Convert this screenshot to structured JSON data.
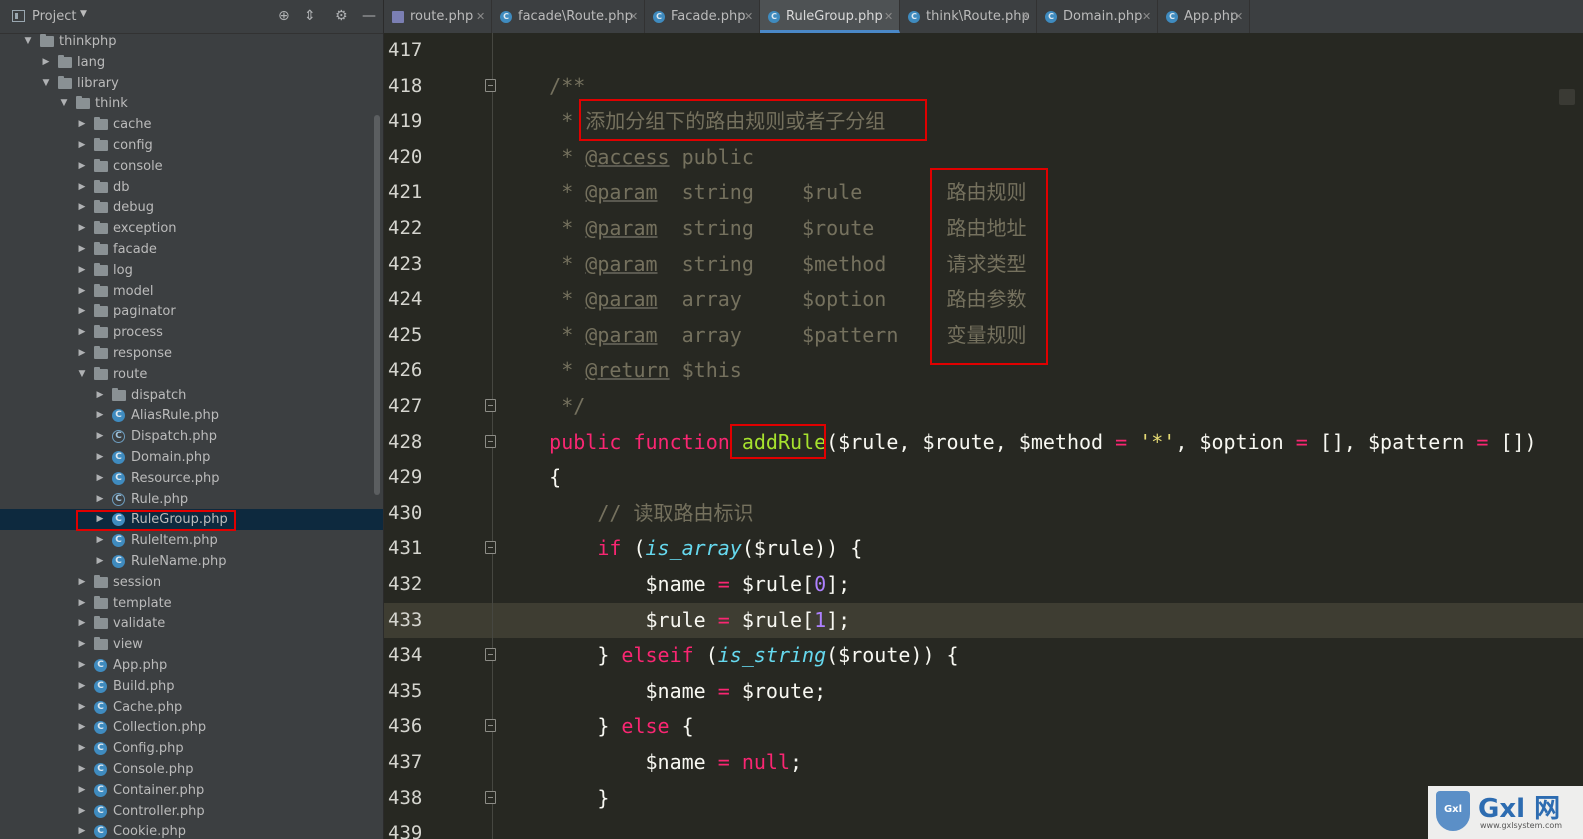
{
  "sidebar": {
    "title": "Project",
    "tree": [
      {
        "label": "thinkphp",
        "type": "folder",
        "depth": 0,
        "expanded": true
      },
      {
        "label": "lang",
        "type": "folder",
        "depth": 1,
        "expanded": false
      },
      {
        "label": "library",
        "type": "folder",
        "depth": 1,
        "expanded": true
      },
      {
        "label": "think",
        "type": "folder",
        "depth": 2,
        "expanded": true
      },
      {
        "label": "cache",
        "type": "folder",
        "depth": 3,
        "expanded": false
      },
      {
        "label": "config",
        "type": "folder",
        "depth": 3,
        "expanded": false
      },
      {
        "label": "console",
        "type": "folder",
        "depth": 3,
        "expanded": false
      },
      {
        "label": "db",
        "type": "folder",
        "depth": 3,
        "expanded": false
      },
      {
        "label": "debug",
        "type": "folder",
        "depth": 3,
        "expanded": false
      },
      {
        "label": "exception",
        "type": "folder",
        "depth": 3,
        "expanded": false
      },
      {
        "label": "facade",
        "type": "folder",
        "depth": 3,
        "expanded": false
      },
      {
        "label": "log",
        "type": "folder",
        "depth": 3,
        "expanded": false
      },
      {
        "label": "model",
        "type": "folder",
        "depth": 3,
        "expanded": false
      },
      {
        "label": "paginator",
        "type": "folder",
        "depth": 3,
        "expanded": false
      },
      {
        "label": "process",
        "type": "folder",
        "depth": 3,
        "expanded": false
      },
      {
        "label": "response",
        "type": "folder",
        "depth": 3,
        "expanded": false
      },
      {
        "label": "route",
        "type": "folder",
        "depth": 3,
        "expanded": true
      },
      {
        "label": "dispatch",
        "type": "folder",
        "depth": 4,
        "expanded": false
      },
      {
        "label": "AliasRule.php",
        "type": "class",
        "depth": 4
      },
      {
        "label": "Dispatch.php",
        "type": "abstract",
        "depth": 4
      },
      {
        "label": "Domain.php",
        "type": "class",
        "depth": 4
      },
      {
        "label": "Resource.php",
        "type": "class",
        "depth": 4
      },
      {
        "label": "Rule.php",
        "type": "abstract",
        "depth": 4
      },
      {
        "label": "RuleGroup.php",
        "type": "class",
        "depth": 4,
        "selected": true
      },
      {
        "label": "RuleItem.php",
        "type": "class",
        "depth": 4
      },
      {
        "label": "RuleName.php",
        "type": "class",
        "depth": 4
      },
      {
        "label": "session",
        "type": "folder",
        "depth": 3,
        "expanded": false
      },
      {
        "label": "template",
        "type": "folder",
        "depth": 3,
        "expanded": false
      },
      {
        "label": "validate",
        "type": "folder",
        "depth": 3,
        "expanded": false
      },
      {
        "label": "view",
        "type": "folder",
        "depth": 3,
        "expanded": false
      },
      {
        "label": "App.php",
        "type": "class",
        "depth": 3
      },
      {
        "label": "Build.php",
        "type": "class",
        "depth": 3
      },
      {
        "label": "Cache.php",
        "type": "class",
        "depth": 3
      },
      {
        "label": "Collection.php",
        "type": "class",
        "depth": 3
      },
      {
        "label": "Config.php",
        "type": "class",
        "depth": 3
      },
      {
        "label": "Console.php",
        "type": "class",
        "depth": 3
      },
      {
        "label": "Container.php",
        "type": "class",
        "depth": 3
      },
      {
        "label": "Controller.php",
        "type": "class",
        "depth": 3
      },
      {
        "label": "Cookie.php",
        "type": "class",
        "depth": 3
      }
    ]
  },
  "tabs": [
    {
      "label": "route.php",
      "icon": "php",
      "active": false
    },
    {
      "label": "facade\\Route.php",
      "icon": "class",
      "active": false
    },
    {
      "label": "Facade.php",
      "icon": "class",
      "active": false
    },
    {
      "label": "RuleGroup.php",
      "icon": "class",
      "active": true
    },
    {
      "label": "think\\Route.php",
      "icon": "class",
      "active": false
    },
    {
      "label": "Domain.php",
      "icon": "class",
      "active": false
    },
    {
      "label": "App.php",
      "icon": "class",
      "active": false
    }
  ],
  "editor": {
    "lines": [
      {
        "n": "417",
        "fold": false,
        "tokens": []
      },
      {
        "n": "418",
        "fold": true,
        "tokens": [
          [
            "c-cm",
            "    /**"
          ]
        ]
      },
      {
        "n": "419",
        "fold": false,
        "tokens": [
          [
            "c-cm",
            "     * 添加分组下的路由规则或者子分组"
          ]
        ]
      },
      {
        "n": "420",
        "fold": false,
        "tokens": [
          [
            "c-cm",
            "     * "
          ],
          [
            "doc-tag",
            "@access"
          ],
          [
            "c-cm",
            " public"
          ]
        ]
      },
      {
        "n": "421",
        "fold": false,
        "tokens": [
          [
            "c-cm",
            "     * "
          ],
          [
            "doc-tag",
            "@param"
          ],
          [
            "c-cm",
            "  string    $rule       路由规则"
          ]
        ]
      },
      {
        "n": "422",
        "fold": false,
        "tokens": [
          [
            "c-cm",
            "     * "
          ],
          [
            "doc-tag",
            "@param"
          ],
          [
            "c-cm",
            "  string    $route      路由地址"
          ]
        ]
      },
      {
        "n": "423",
        "fold": false,
        "tokens": [
          [
            "c-cm",
            "     * "
          ],
          [
            "doc-tag",
            "@param"
          ],
          [
            "c-cm",
            "  string    $method     请求类型"
          ]
        ]
      },
      {
        "n": "424",
        "fold": false,
        "tokens": [
          [
            "c-cm",
            "     * "
          ],
          [
            "doc-tag",
            "@param"
          ],
          [
            "c-cm",
            "  array     $option     路由参数"
          ]
        ]
      },
      {
        "n": "425",
        "fold": false,
        "tokens": [
          [
            "c-cm",
            "     * "
          ],
          [
            "doc-tag",
            "@param"
          ],
          [
            "c-cm",
            "  array     $pattern    变量规则"
          ]
        ]
      },
      {
        "n": "426",
        "fold": false,
        "tokens": [
          [
            "c-cm",
            "     * "
          ],
          [
            "doc-tag",
            "@return"
          ],
          [
            "c-cm",
            " $this"
          ]
        ]
      },
      {
        "n": "427",
        "fold": true,
        "tokens": [
          [
            "c-cm",
            "     */"
          ]
        ]
      },
      {
        "n": "428",
        "fold": true,
        "tokens": [
          [
            "c-pl",
            "    "
          ],
          [
            "c-kw",
            "public"
          ],
          [
            "c-pl",
            " "
          ],
          [
            "c-kw",
            "function"
          ],
          [
            "c-pl",
            " "
          ],
          [
            "c-fn",
            "addRule"
          ],
          [
            "c-pl",
            "($rule, $route, $method "
          ],
          [
            "c-op",
            "="
          ],
          [
            "c-pl",
            " "
          ],
          [
            "c-str",
            "'*'"
          ],
          [
            "c-pl",
            ", $option "
          ],
          [
            "c-op",
            "="
          ],
          [
            "c-pl",
            " [], $pattern "
          ],
          [
            "c-op",
            "="
          ],
          [
            "c-pl",
            " [])"
          ]
        ]
      },
      {
        "n": "429",
        "fold": false,
        "tokens": [
          [
            "c-pl",
            "    {"
          ]
        ]
      },
      {
        "n": "430",
        "fold": false,
        "tokens": [
          [
            "c-cm",
            "        // 读取路由标识"
          ]
        ]
      },
      {
        "n": "431",
        "fold": true,
        "tokens": [
          [
            "c-pl",
            "        "
          ],
          [
            "c-kw",
            "if"
          ],
          [
            "c-pl",
            " ("
          ],
          [
            "c-bi",
            "is_array"
          ],
          [
            "c-pl",
            "($rule)) {"
          ]
        ]
      },
      {
        "n": "432",
        "fold": false,
        "tokens": [
          [
            "c-pl",
            "            $name "
          ],
          [
            "c-op",
            "="
          ],
          [
            "c-pl",
            " $rule["
          ],
          [
            "c-num",
            "0"
          ],
          [
            "c-pl",
            "];"
          ]
        ]
      },
      {
        "n": "433",
        "fold": false,
        "tokens": [
          [
            "c-pl",
            "            $rule "
          ],
          [
            "c-op",
            "="
          ],
          [
            "c-pl",
            " $rule["
          ],
          [
            "c-num",
            "1"
          ],
          [
            "c-pl",
            "];"
          ]
        ]
      },
      {
        "n": "434",
        "fold": true,
        "tokens": [
          [
            "c-pl",
            "        } "
          ],
          [
            "c-kw",
            "elseif"
          ],
          [
            "c-pl",
            " ("
          ],
          [
            "c-bi",
            "is_string"
          ],
          [
            "c-pl",
            "($route)) {"
          ]
        ]
      },
      {
        "n": "435",
        "fold": false,
        "tokens": [
          [
            "c-pl",
            "            $name "
          ],
          [
            "c-op",
            "="
          ],
          [
            "c-pl",
            " $route;"
          ]
        ]
      },
      {
        "n": "436",
        "fold": true,
        "tokens": [
          [
            "c-pl",
            "        } "
          ],
          [
            "c-kw",
            "else"
          ],
          [
            "c-pl",
            " {"
          ]
        ]
      },
      {
        "n": "437",
        "fold": false,
        "tokens": [
          [
            "c-pl",
            "            $name "
          ],
          [
            "c-op",
            "="
          ],
          [
            "c-pl",
            " "
          ],
          [
            "c-kw",
            "null"
          ],
          [
            "c-pl",
            ";"
          ]
        ]
      },
      {
        "n": "438",
        "fold": true,
        "tokens": [
          [
            "c-pl",
            "        }"
          ]
        ]
      },
      {
        "n": "439",
        "fold": false,
        "tokens": []
      }
    ]
  },
  "watermark": {
    "brand": "Gxl 网",
    "badge": "Gxl",
    "url": "www.gxlsystem.com"
  }
}
